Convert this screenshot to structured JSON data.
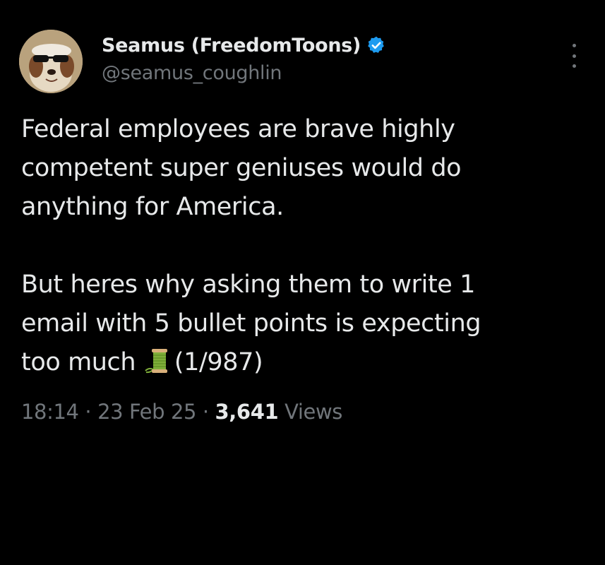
{
  "author": {
    "display_name": "Seamus (FreedomToons)",
    "handle": "@seamus_coughlin",
    "verified": true,
    "verified_badge_color": "#1d9bf0"
  },
  "tweet": {
    "lines_para1": [
      "Federal employees are brave highly",
      "competent super geniuses would do",
      "anything for America."
    ],
    "lines_para2": [
      "But heres why asking them to write 1",
      "email with 5 bullet points is expecting"
    ],
    "last_line_text": "too much",
    "emoji": "spool-of-thread",
    "thread_counter": "(1/987)"
  },
  "meta": {
    "time": "18:14",
    "separator": "·",
    "date": "23 Feb 25",
    "views_count": "3,641",
    "views_label": "Views"
  },
  "icons": {
    "more": "more-vertical-icon",
    "verified": "verified-badge-icon"
  },
  "colors": {
    "background": "#000000",
    "primary_text": "#e7e9ea",
    "secondary_text": "#71767b"
  }
}
